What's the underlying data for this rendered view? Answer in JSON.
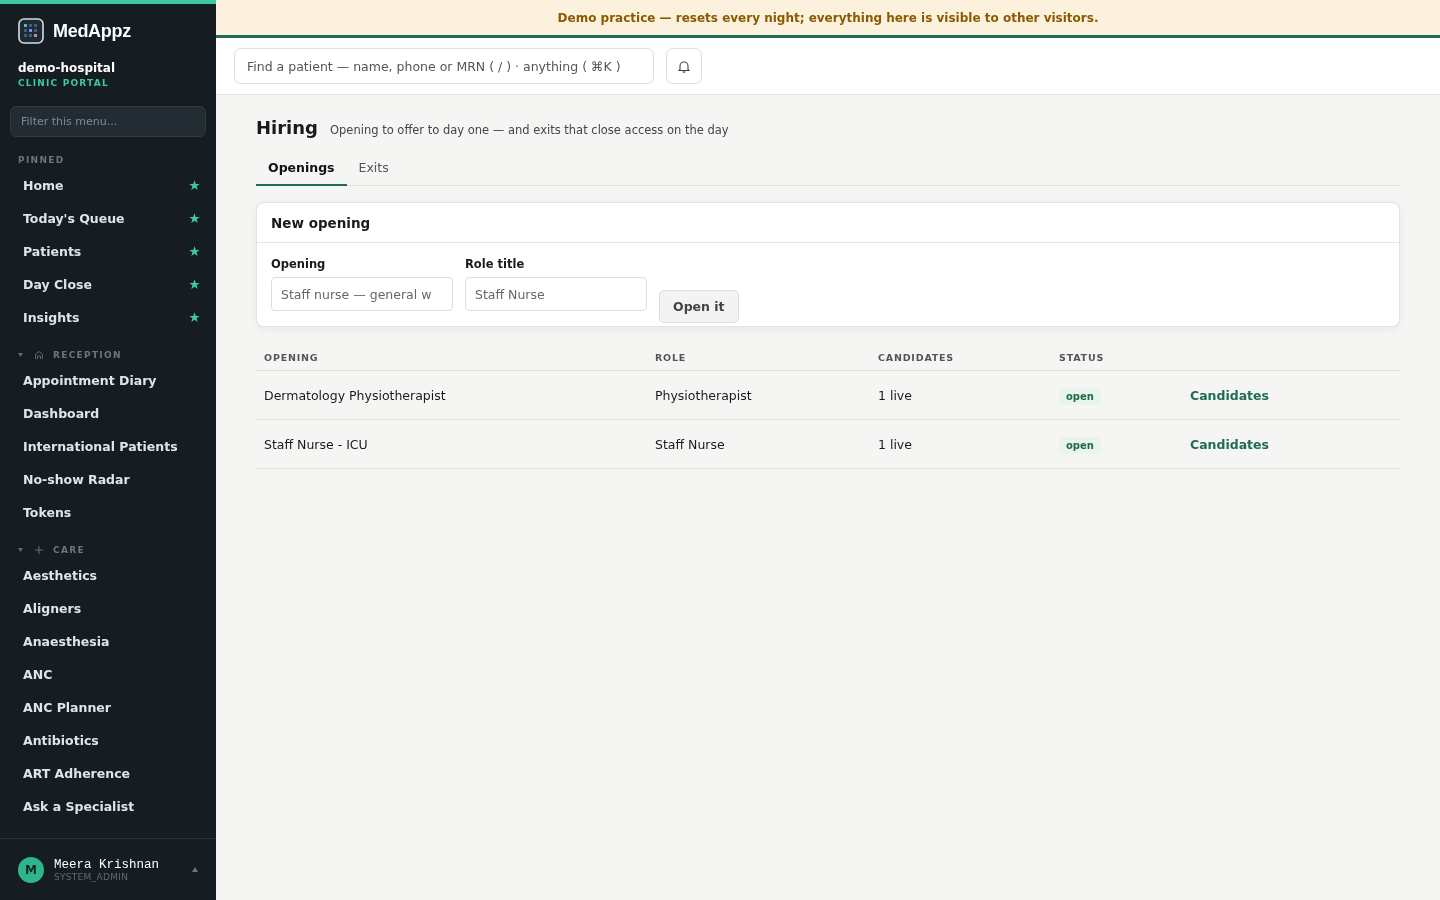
{
  "banner": {
    "text": "Demo practice — resets every night; everything here is visible to other visitors."
  },
  "sidebar": {
    "brand": "MedAppz",
    "org": "demo-hospital",
    "portal": "CLINIC PORTAL",
    "filter": {
      "placeholder": "Filter this menu..."
    },
    "sections": [
      {
        "kind": "pinned",
        "title": "PINNED",
        "items": [
          {
            "label": "Home",
            "pinned": true
          },
          {
            "label": "Today's Queue",
            "pinned": true
          },
          {
            "label": "Patients",
            "pinned": true
          },
          {
            "label": "Day Close",
            "pinned": true
          },
          {
            "label": "Insights",
            "pinned": true
          }
        ]
      },
      {
        "kind": "group",
        "title": "RECEPTION",
        "expanded": true,
        "items": [
          {
            "label": "Appointment Diary",
            "pinned": false
          },
          {
            "label": "Dashboard",
            "pinned": false
          },
          {
            "label": "International Patients",
            "pinned": false
          },
          {
            "label": "No-show Radar",
            "pinned": false
          },
          {
            "label": "Tokens",
            "pinned": false
          }
        ]
      },
      {
        "kind": "group",
        "title": "CARE",
        "expanded": true,
        "items": [
          {
            "label": "Aesthetics",
            "pinned": false
          },
          {
            "label": "Aligners",
            "pinned": false
          },
          {
            "label": "Anaesthesia",
            "pinned": false
          },
          {
            "label": "ANC",
            "pinned": false
          },
          {
            "label": "ANC Planner",
            "pinned": false
          },
          {
            "label": "Antibiotics",
            "pinned": false
          },
          {
            "label": "ART Adherence",
            "pinned": false
          },
          {
            "label": "Ask a Specialist",
            "pinned": false
          }
        ]
      }
    ],
    "user": {
      "initial": "M",
      "name": "Meera Krishnan",
      "role": "SYSTEM_ADMIN"
    }
  },
  "search": {
    "placeholder": "Find a patient — name, phone or MRN ( / ) · anything ( ⌘K )"
  },
  "page": {
    "title": "Hiring",
    "subtitle": "Opening to offer to day one — and exits that close access on the day",
    "tabs": [
      {
        "label": "Openings",
        "selected": true
      },
      {
        "label": "Exits",
        "selected": false
      }
    ],
    "form": {
      "title": "New opening",
      "fields": [
        {
          "label": "Opening",
          "placeholder": "Staff nurse — general w"
        },
        {
          "label": "Role title",
          "placeholder": "Staff Nurse"
        }
      ],
      "button": "Open it"
    },
    "table": {
      "columns": [
        "OPENING",
        "ROLE",
        "CANDIDATES",
        "STATUS"
      ],
      "rows": [
        {
          "opening": "Dermatology Physiotherapist",
          "role": "Physiotherapist",
          "candidates": "1 live",
          "status": "open",
          "action": "Candidates"
        },
        {
          "opening": "Staff Nurse - ICU",
          "role": "Staff Nurse",
          "candidates": "1 live",
          "status": "open",
          "action": "Candidates"
        }
      ]
    }
  }
}
